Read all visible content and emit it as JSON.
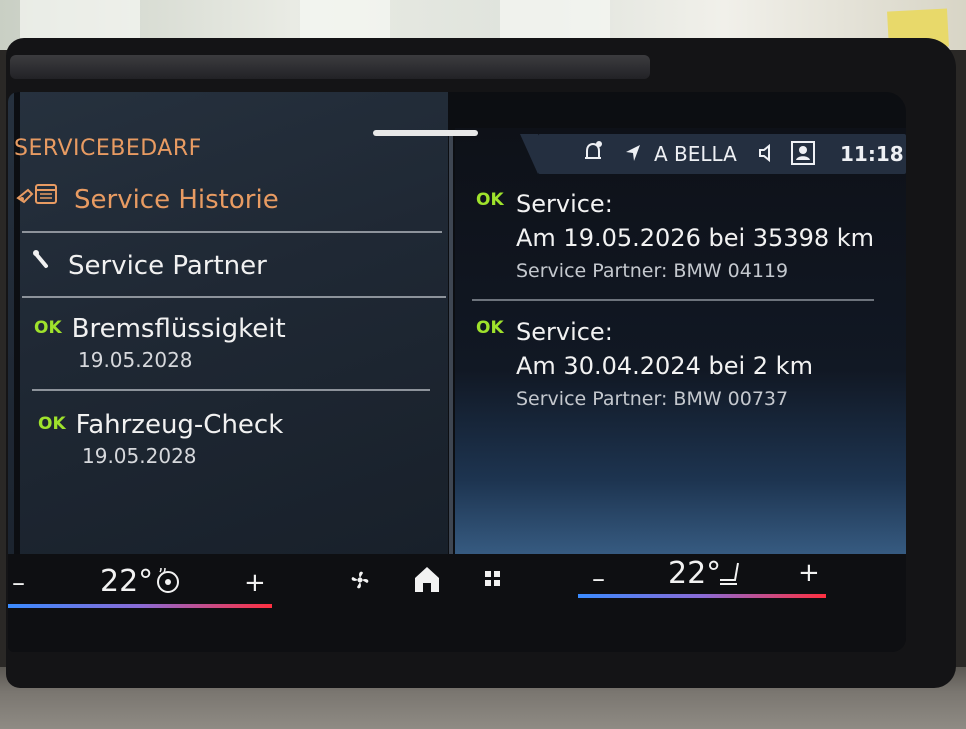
{
  "header": {
    "section_title": "SERVICEBEDARF"
  },
  "status_bar": {
    "profile_name": "A BELLA",
    "time": "11:18",
    "icons": [
      "bell-icon",
      "navigation-arrow-icon",
      "speaker-icon",
      "profile-icon"
    ]
  },
  "menu": {
    "items": [
      {
        "label": "Service Historie",
        "icon": "service-history-icon"
      },
      {
        "label": "Service Partner",
        "icon": "wrench-icon"
      }
    ],
    "checks": [
      {
        "status": "OK",
        "label": "Bremsflüssigkeit",
        "date": "19.05.2028"
      },
      {
        "status": "OK",
        "label": "Fahrzeug-Check",
        "date": "19.05.2028"
      }
    ]
  },
  "history": [
    {
      "status": "OK",
      "title": "Service:",
      "detail": "Am 19.05.2026 bei 35398 km",
      "partner": "Service Partner: BMW 04119"
    },
    {
      "status": "OK",
      "title": "Service:",
      "detail": "Am 30.04.2024 bei 2 km",
      "partner": "Service Partner: BMW 00737"
    }
  ],
  "climate": {
    "left": {
      "minus": "–",
      "temp": "22°",
      "plus": "+"
    },
    "right": {
      "minus": "–",
      "temp": "22°",
      "plus": "+"
    }
  },
  "colors": {
    "accent_orange": "#e89b62",
    "ok_green": "#9fe22c",
    "status_bar_bg": "#242f40"
  }
}
